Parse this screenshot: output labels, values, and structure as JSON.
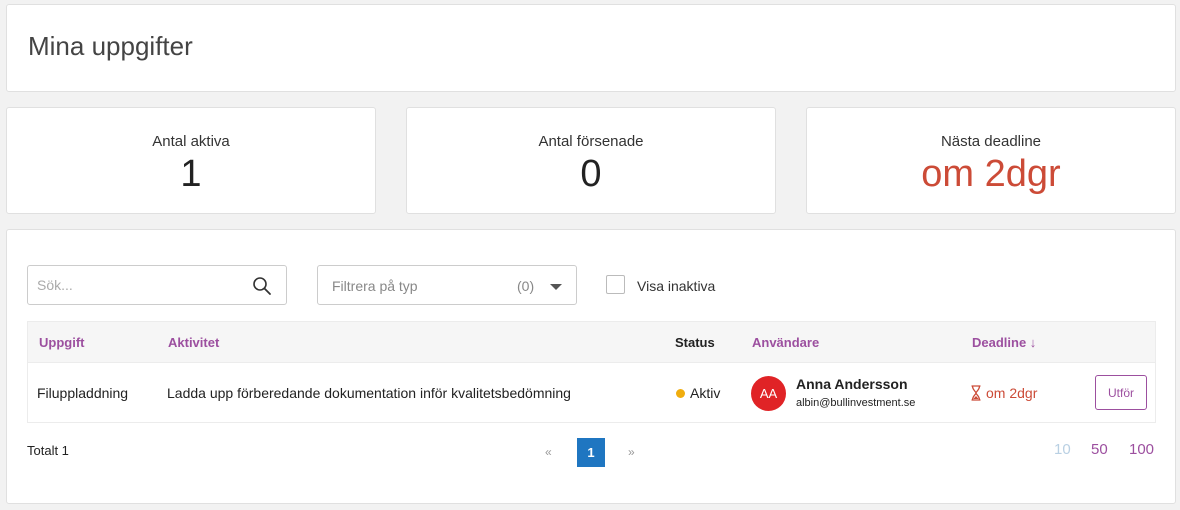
{
  "page": {
    "title": "Mina uppgifter"
  },
  "stats": [
    {
      "label": "Antal aktiva",
      "value": "1"
    },
    {
      "label": "Antal försenade",
      "value": "0"
    },
    {
      "label": "Nästa deadline",
      "value": "om 2dgr",
      "value_color": "#cc4b37"
    }
  ],
  "toolbar": {
    "search_placeholder": "Sök...",
    "search_icon": "search-icon",
    "filter_label": "Filtrera på typ",
    "filter_count": "(0)",
    "show_inactive_label": "Visa inaktiva",
    "show_inactive_checked": false
  },
  "table": {
    "columns": [
      "Uppgift",
      "Aktivitet",
      "Status",
      "Användare",
      "Deadline ↓"
    ],
    "rows": [
      {
        "task": "Filuppladdning",
        "activity": "Ladda upp förberedande dokumentation inför kvalitetsbedömning",
        "status": "Aktiv",
        "status_color": "#f0ad0e",
        "user_initials": "AA",
        "user_name": "Anna Andersson",
        "user_email": "albin@bullinvestment.se",
        "deadline": "om 2dgr",
        "action": "Utför"
      }
    ]
  },
  "footer": {
    "total": "Totalt 1",
    "prev": "«",
    "current_page": "1",
    "next": "»",
    "page_sizes": [
      "10",
      "50",
      "100"
    ],
    "active_page_size": "10"
  },
  "colors": {
    "accent": "#9c4f9f",
    "danger": "#cc4b37",
    "primary": "#1f76c1"
  }
}
